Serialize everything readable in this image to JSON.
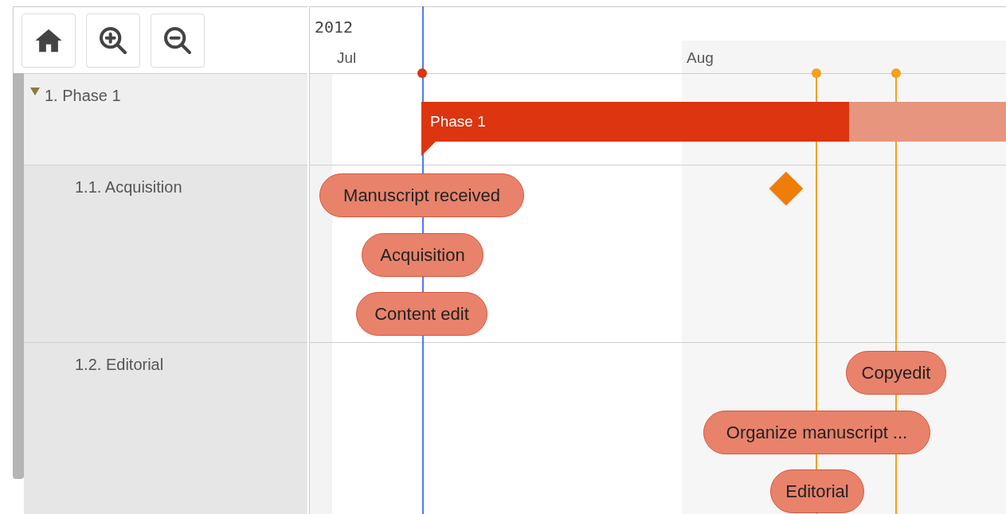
{
  "toolbar": [
    {
      "kind": "home"
    },
    {
      "kind": "zoom_in"
    },
    {
      "kind": "zoom_out"
    }
  ],
  "tree": [
    {
      "label": "1. Phase 1",
      "expanded": true,
      "children": [
        {
          "label": "1.1. Acquisition"
        },
        {
          "label": "1.2. Editorial"
        }
      ]
    }
  ],
  "timeline": {
    "year": "2012",
    "months": [
      "Jul",
      "Aug"
    ]
  },
  "summary_bar": {
    "label": "Phase 1"
  },
  "lanes": [
    {
      "tasks": [
        {
          "kind": "task",
          "label": "Manuscript received"
        },
        {
          "kind": "milestone"
        },
        {
          "kind": "task",
          "label": "Acquisition"
        },
        {
          "kind": "task",
          "label": "Content edit"
        }
      ]
    },
    {
      "tasks": [
        {
          "kind": "task",
          "label": "Copyedit"
        },
        {
          "kind": "task",
          "label": "Organize manuscript ..."
        },
        {
          "kind": "task",
          "label": "Editorial"
        }
      ]
    }
  ]
}
